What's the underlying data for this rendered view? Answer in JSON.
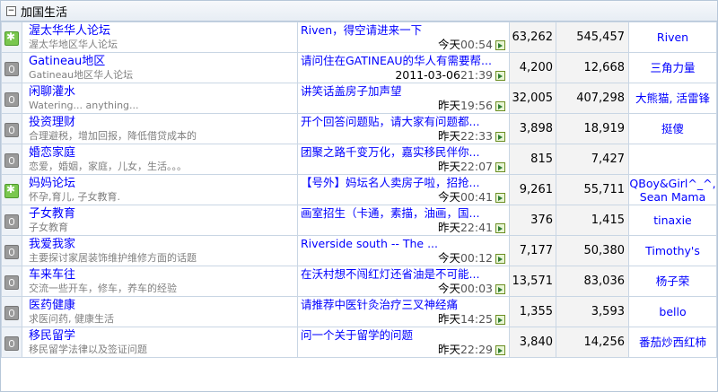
{
  "category": {
    "toggle": "−",
    "title": "加国生活"
  },
  "forums": [
    {
      "icon": "new",
      "name": "渥太华华人论坛",
      "desc": "渥太华地区华人论坛",
      "last_title": "Riven，得空请进来一下",
      "last_day": "今天",
      "last_time": "00:54",
      "topics": "63,262",
      "posts": "545,457",
      "moderators": [
        "Riven"
      ]
    },
    {
      "icon": "old",
      "name": "Gatineau地区",
      "desc": "Gatineau地区华人论坛",
      "last_title": "请问住在GATINEAU的华人有需要帮...",
      "last_day": "2011-03-06",
      "last_time": "21:39",
      "topics": "4,200",
      "posts": "12,668",
      "moderators": [
        "三角力量"
      ]
    },
    {
      "icon": "old",
      "name": "闲聊灌水",
      "desc": "Watering... anything...",
      "last_title": "讲笑话盖房子加声望",
      "last_day": "昨天",
      "last_time": "19:56",
      "topics": "32,005",
      "posts": "407,298",
      "moderators": [
        "大熊猫, 活雷锋"
      ]
    },
    {
      "icon": "old",
      "name": "投资理财",
      "desc": "合理避税，增加回报，降低借贷成本的",
      "last_title": "开个回答问题贴，请大家有问题都...",
      "last_day": "昨天",
      "last_time": "22:33",
      "topics": "3,898",
      "posts": "18,919",
      "moderators": [
        "挺傻"
      ]
    },
    {
      "icon": "old",
      "name": "婚恋家庭",
      "desc": "恋爱，婚姻，家庭，儿女，生活。。。",
      "last_title": "团聚之路千变万化，嘉实移民伴你...",
      "last_day": "昨天",
      "last_time": "22:07",
      "topics": "815",
      "posts": "7,427",
      "moderators": [
        ""
      ]
    },
    {
      "icon": "new",
      "name": "妈妈论坛",
      "desc": "怀孕,育儿, 子女教育.",
      "last_title": "【号外】妈坛名人卖房子啦，招抢...",
      "last_day": "今天",
      "last_time": "00:41",
      "topics": "9,261",
      "posts": "55,711",
      "moderators": [
        "QBoy&Girl^_^,",
        "Sean Mama"
      ]
    },
    {
      "icon": "old",
      "name": "子女教育",
      "desc": "子女教育",
      "last_title": "画室招生（卡通，素描，油画，国...",
      "last_day": "昨天",
      "last_time": "22:41",
      "topics": "376",
      "posts": "1,415",
      "moderators": [
        "tinaxie"
      ]
    },
    {
      "icon": "old",
      "name": "我爱我家",
      "desc": "主要探讨家居装饰维护维修方面的话题",
      "last_title": "Riverside south -- The ...",
      "last_day": "今天",
      "last_time": "00:12",
      "topics": "7,177",
      "posts": "50,380",
      "moderators": [
        "Timothy's"
      ]
    },
    {
      "icon": "old",
      "name": "车来车往",
      "desc": "交流一些开车，修车，养车的经验",
      "last_title": "在沃村想不闯红灯还省油是不可能...",
      "last_day": "今天",
      "last_time": "00:03",
      "topics": "13,571",
      "posts": "83,036",
      "moderators": [
        "杨子荣"
      ]
    },
    {
      "icon": "old",
      "name": "医药健康",
      "desc": "求医问药, 健康生活",
      "last_title": "请推荐中医针灸治疗三叉神经痛",
      "last_day": "昨天",
      "last_time": "14:25",
      "topics": "1,355",
      "posts": "3,593",
      "moderators": [
        "bello"
      ]
    },
    {
      "icon": "old",
      "name": "移民留学",
      "desc": "移民留学法律以及签证问题",
      "last_title": "问一个关于留学的问题",
      "last_day": "昨天",
      "last_time": "22:29",
      "topics": "3,840",
      "posts": "14,256",
      "moderators": [
        "番茄炒西红柿"
      ]
    }
  ]
}
